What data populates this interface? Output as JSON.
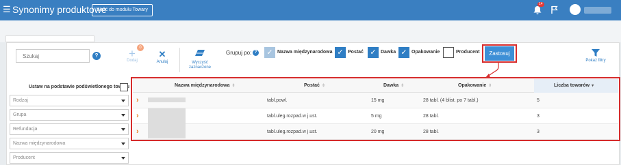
{
  "header": {
    "menu_icon": "hamburger-icon",
    "title": "Synonimy produktowe",
    "back_button": "Wróć do modułu Towary",
    "notifications_count": "14",
    "notification_icon": "bell-icon",
    "flag_icon": "flag-icon",
    "avatar_icon": "user-avatar-icon"
  },
  "search": {
    "placeholder": "Szukaj",
    "info": "?"
  },
  "toolbar": {
    "add": {
      "label": "Dodaj",
      "badge": "0",
      "icon": "plus-icon"
    },
    "cancel": {
      "label": "Anuluj",
      "icon": "close-icon"
    },
    "clear": {
      "label_line1": "Wyczyść",
      "label_line2": "zaznaczone",
      "icon": "eraser-icon"
    }
  },
  "groupby": {
    "label": "Grupuj po:",
    "info": "?",
    "options": [
      {
        "label": "Nazwa międzynarodowa",
        "checked": true,
        "disabled": true
      },
      {
        "label": "Postać",
        "checked": true,
        "disabled": false
      },
      {
        "label": "Dawka",
        "checked": true,
        "disabled": false
      },
      {
        "label": "Opakowanie",
        "checked": true,
        "disabled": false
      },
      {
        "label": "Producent",
        "checked": false,
        "disabled": false
      }
    ],
    "apply_label": "Zastosuj"
  },
  "show_filters": {
    "label": "Pokaż filtry",
    "icon": "funnel-icon"
  },
  "left_panel": {
    "set_label": "Ustaw na podstawie podświetlonego towaru",
    "filters": [
      "Rodzaj",
      "Grupa",
      "Refundacja",
      "Nazwa międzynarodowa",
      "Producent"
    ]
  },
  "grid": {
    "columns": [
      "Nazwa międzynarodowa",
      "Postać",
      "Dawka",
      "Opakowanie",
      "Liczba towarów"
    ],
    "sort_icon": "⇕",
    "sorted_icon": "▾",
    "rows": [
      {
        "name": "",
        "postac": "tabl.powl.",
        "dawka": "15 mg",
        "opakowanie": "28 tabl. (4 blist. po 7 tabl.)",
        "liczba": "5"
      },
      {
        "name": "",
        "postac": "tabl.uleg.rozpad.w j.ust.",
        "dawka": "5 mg",
        "opakowanie": "28 tabl.",
        "liczba": "3"
      },
      {
        "name": "",
        "postac": "tabl.uleg.rozpad.w j.ust.",
        "dawka": "20 mg",
        "opakowanie": "28 tabl.",
        "liczba": "3"
      }
    ]
  },
  "colors": {
    "header": "#3a7fc1",
    "accent": "#2f7ec4",
    "highlight": "#d62c2c",
    "expand": "#e67e22"
  }
}
